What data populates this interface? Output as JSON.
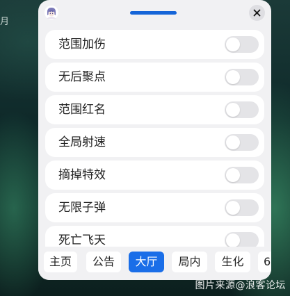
{
  "background": {
    "edge_text": "月",
    "watermark": "图片来源@浪客论坛"
  },
  "panel": {
    "avatar_icon": "anime-avatar-icon",
    "close_icon": "close-x-icon",
    "accent_color": "#1a6ee8"
  },
  "options": [
    {
      "label": "范围加伤",
      "enabled": false
    },
    {
      "label": "无后聚点",
      "enabled": false
    },
    {
      "label": "范围红名",
      "enabled": false
    },
    {
      "label": "全局射速",
      "enabled": false
    },
    {
      "label": "摘掉特效",
      "enabled": false
    },
    {
      "label": "无限子弹",
      "enabled": false
    },
    {
      "label": "死亡飞天",
      "enabled": false
    }
  ],
  "tabs": [
    {
      "label": "主页",
      "active": false
    },
    {
      "label": "公告",
      "active": false
    },
    {
      "label": "大厅",
      "active": true
    },
    {
      "label": "局内",
      "active": false
    },
    {
      "label": "生化",
      "active": false
    },
    {
      "label": "6",
      "active": false
    }
  ]
}
